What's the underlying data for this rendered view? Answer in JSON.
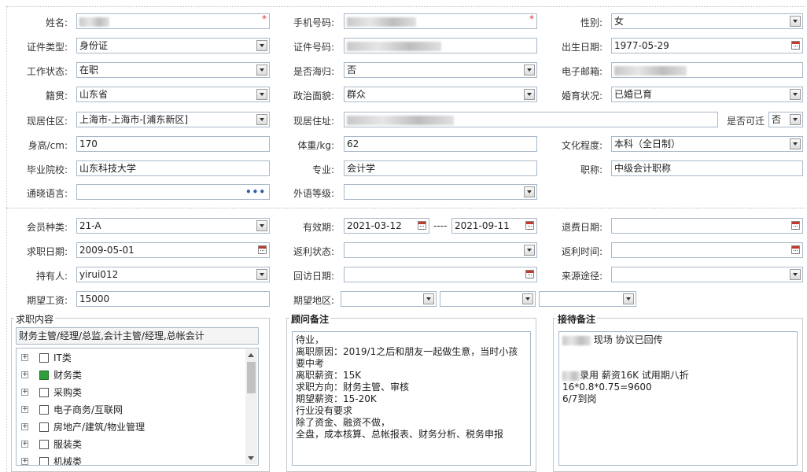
{
  "personal": {
    "name": {
      "label": "姓名:",
      "value": ""
    },
    "phone": {
      "label": "手机号码:",
      "value": ""
    },
    "gender": {
      "label": "性别:",
      "value": "女"
    },
    "id_type": {
      "label": "证件类型:",
      "value": "身份证"
    },
    "id_number": {
      "label": "证件号码:",
      "value": ""
    },
    "birth_date": {
      "label": "出生日期:",
      "value": "1977-05-29"
    },
    "work_status": {
      "label": "工作状态:",
      "value": "在职"
    },
    "returnee": {
      "label": "是否海归:",
      "value": "否"
    },
    "email": {
      "label": "电子邮箱:",
      "value": ""
    },
    "native_place": {
      "label": "籍贯:",
      "value": "山东省"
    },
    "political": {
      "label": "政治面貌:",
      "value": "群众"
    },
    "marital": {
      "label": "婚育状况:",
      "value": "已婚已育"
    },
    "current_area": {
      "label": "现居住区:",
      "value": "上海市-上海市-[浦东新区]"
    },
    "current_address": {
      "label": "现居住址:",
      "value": ""
    },
    "relocate": {
      "label": "是否可迁",
      "value": "否"
    },
    "height": {
      "label": "身高/cm:",
      "value": "170"
    },
    "weight": {
      "label": "体重/kg:",
      "value": "62"
    },
    "education": {
      "label": "文化程度:",
      "value": "本科（全日制）"
    },
    "school": {
      "label": "毕业院校:",
      "value": "山东科技大学"
    },
    "major": {
      "label": "专业:",
      "value": "会计学"
    },
    "title": {
      "label": "职称:",
      "value": "中级会计职称"
    },
    "languages": {
      "label": "通晓语言:",
      "value": "",
      "picker": "•••"
    },
    "foreign_level": {
      "label": "外语等级:",
      "value": ""
    }
  },
  "membership": {
    "member_type": {
      "label": "会员种类:",
      "value": "21-A"
    },
    "validity": {
      "label": "有效期:",
      "start": "2021-03-12",
      "dash": "----",
      "end": "2021-09-11"
    },
    "refund_date": {
      "label": "退费日期:",
      "value": ""
    },
    "job_date": {
      "label": "求职日期:",
      "value": "2009-05-01"
    },
    "rebate_status": {
      "label": "返利状态:",
      "value": ""
    },
    "rebate_time": {
      "label": "返利时间:",
      "value": ""
    },
    "holder": {
      "label": "持有人:",
      "value": "yirui012"
    },
    "visit_date": {
      "label": "回访日期:",
      "value": ""
    },
    "source": {
      "label": "来源途径:",
      "value": ""
    },
    "expected_salary": {
      "label": "期望工资:",
      "value": "15000"
    },
    "expected_region": {
      "label": "期望地区:",
      "values": [
        "",
        "",
        ""
      ]
    }
  },
  "job_content": {
    "title": "求职内容",
    "summary": "财务主管/经理/总监,会计主管/经理,总帐会计",
    "tree": [
      {
        "label": "IT类",
        "checked": false
      },
      {
        "label": "财务类",
        "checked": true
      },
      {
        "label": "采购类",
        "checked": false
      },
      {
        "label": "电子商务/互联网",
        "checked": false
      },
      {
        "label": "房地产/建筑/物业管理",
        "checked": false
      },
      {
        "label": "服装类",
        "checked": false
      },
      {
        "label": "机械类",
        "checked": false
      }
    ]
  },
  "consultant_notes": {
    "title": "顾问备注",
    "text": "待业，\n离职原因：2019/1之后和朋友一起做生意，当时小孩要中考\n离职薪资：15K\n求职方向：财务主管、审核\n期望薪资：15-20K\n行业没有要求\n除了资金、融资不做，\n全盘，成本核算、总帐报表、财务分析、税务申报"
  },
  "reception_notes": {
    "title": "接待备注",
    "line1": "现场 协议已回传",
    "line2": "录用  薪资16K 试用期八折",
    "line3": "16*0.8*0.75=9600",
    "line4": "6/7到岗"
  },
  "colors": {
    "required": "#e03030",
    "checked": "#2e9e3a",
    "border": "#a9b8c8"
  }
}
